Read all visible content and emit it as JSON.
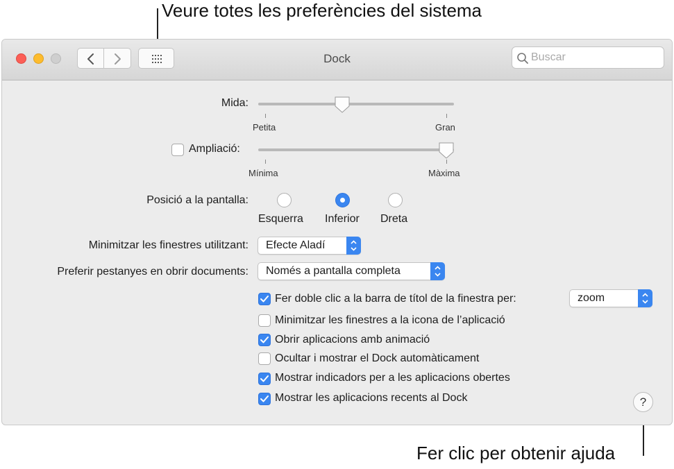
{
  "callouts": {
    "top": "Veure totes les preferències del sistema",
    "bottom": "Fer clic per obtenir ajuda"
  },
  "window": {
    "title": "Dock",
    "search_placeholder": "Buscar"
  },
  "size": {
    "label": "Mida:",
    "min_label": "Petita",
    "max_label": "Gran",
    "value": 0.43
  },
  "magnification": {
    "checked": false,
    "label": "Ampliació:",
    "min_label": "Mínima",
    "max_label": "Màxima",
    "value": 1.0
  },
  "position": {
    "label": "Posició a la pantalla:",
    "options": [
      "Esquerra",
      "Inferior",
      "Dreta"
    ],
    "selected": "Inferior"
  },
  "minimize_effect": {
    "label": "Minimitzar les finestres utilitzant:",
    "value": "Efecte Aladí"
  },
  "prefer_tabs": {
    "label": "Preferir pestanyes en obrir documents:",
    "value": "Només a pantalla completa"
  },
  "double_click": {
    "checked": true,
    "label": "Fer doble clic a la barra de títol de la finestra per:",
    "value": "zoom"
  },
  "checkboxes": [
    {
      "label": "Minimitzar les finestres a la icona de l’aplicació",
      "checked": false
    },
    {
      "label": "Obrir aplicacions amb animació",
      "checked": true
    },
    {
      "label": "Ocultar i mostrar el Dock automàticament",
      "checked": false
    },
    {
      "label": "Mostrar indicadors per a les aplicacions obertes",
      "checked": true
    },
    {
      "label": "Mostrar les aplicacions recents al Dock",
      "checked": true
    }
  ],
  "help": {
    "label": "?"
  },
  "colors": {
    "accent": "#3a86f0",
    "close": "#fc5f57",
    "minimize": "#fdbc2e"
  }
}
